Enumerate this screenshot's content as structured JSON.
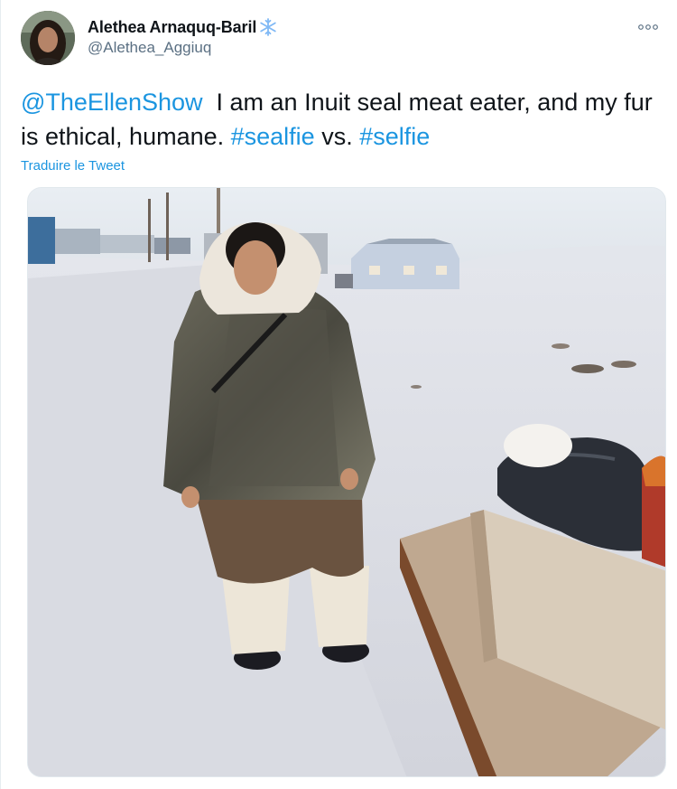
{
  "author": {
    "display_name": "Alethea Arnaquq-Baril",
    "badge_icon": "snowflake-icon",
    "handle": "@Alethea_Aggiuq"
  },
  "tweet": {
    "mention": "@TheEllenShow",
    "text_main": "  I am an Inuit seal meat eater, and my fur is ethical, humane. ",
    "hashtag_1": "#sealfie",
    "text_between": " vs. ",
    "hashtag_2": "#selfie",
    "translate_label": "Traduire le Tweet"
  },
  "icons": {
    "more": "more-horizontal-icon"
  },
  "colors": {
    "link": "#1b95e0",
    "secondary_text": "#5b7083",
    "badge": "#80b9f5"
  }
}
